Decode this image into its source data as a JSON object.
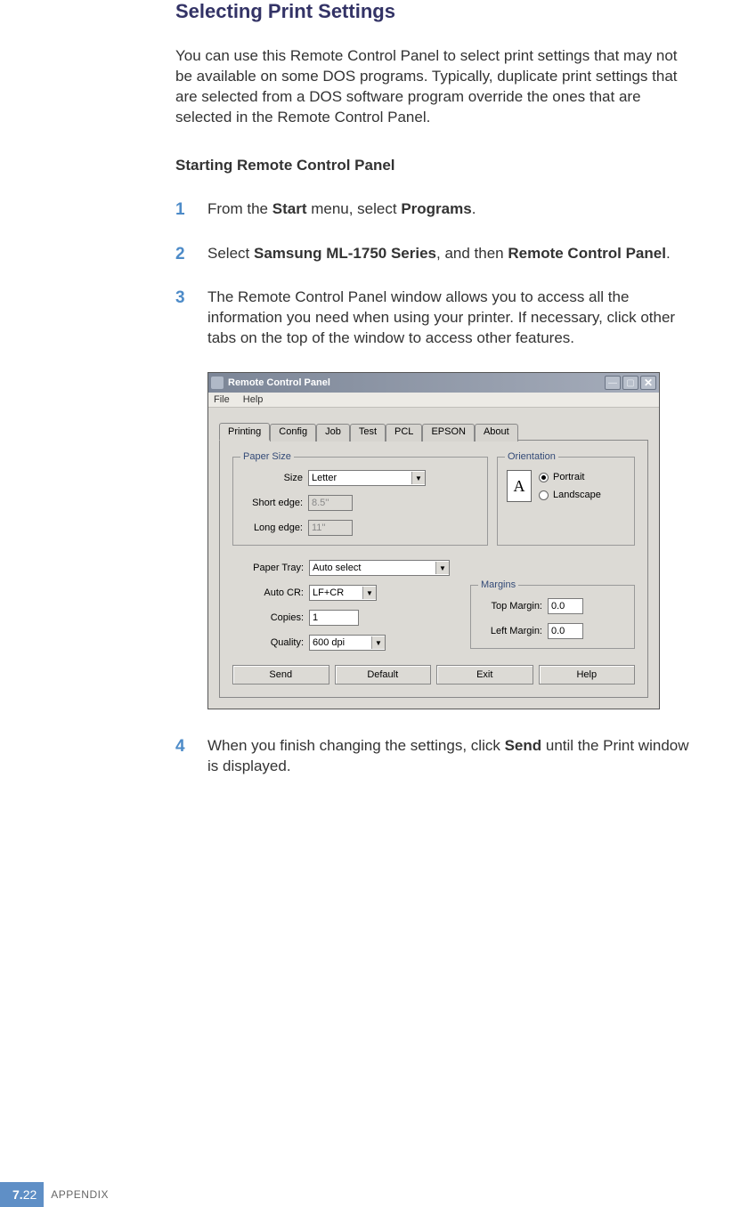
{
  "heading": "Selecting Print Settings",
  "intro": "You can use this Remote Control Panel to select print settings that may not be available on some DOS programs. Typically, duplicate print settings that are selected from a DOS software program override the ones that are selected in the Remote Control Panel.",
  "subheading": "Starting Remote Control Panel",
  "steps": {
    "s1": {
      "num": "1",
      "t1": "From the ",
      "b1": "Start",
      "t2": " menu, select ",
      "b2": "Programs",
      "t3": "."
    },
    "s2": {
      "num": "2",
      "t1": "Select ",
      "b1": "Samsung ML-1750 Series",
      "t2": ", and then ",
      "b2": "Remote Control Panel",
      "t3": "."
    },
    "s3": {
      "num": "3",
      "text": "The Remote Control Panel window allows you to access all the information you need when using your printer. If necessary, click other tabs on the top of the window to access other features."
    },
    "s4": {
      "num": "4",
      "t1": "When you finish changing the settings, click ",
      "b1": "Send",
      "t2": " until the Print window is displayed."
    }
  },
  "dialog": {
    "title": "Remote Control Panel",
    "menu": {
      "file": "File",
      "help": "Help"
    },
    "tabs": [
      "Printing",
      "Config",
      "Job",
      "Test",
      "PCL",
      "EPSON",
      "About"
    ],
    "paper_size": {
      "legend": "Paper Size",
      "size_label": "Size",
      "size_value": "Letter",
      "short_label": "Short edge:",
      "short_value": "8.5''",
      "long_label": "Long edge:",
      "long_value": "11''"
    },
    "orientation": {
      "legend": "Orientation",
      "icon_letter": "A",
      "portrait": "Portrait",
      "landscape": "Landscape"
    },
    "fields": {
      "tray_label": "Paper Tray:",
      "tray_value": "Auto select",
      "autocr_label": "Auto CR:",
      "autocr_value": "LF+CR",
      "copies_label": "Copies:",
      "copies_value": "1",
      "quality_label": "Quality:",
      "quality_value": "600 dpi"
    },
    "margins": {
      "legend": "Margins",
      "top_label": "Top Margin:",
      "top_value": "0.0",
      "left_label": "Left Margin:",
      "left_value": "0.0"
    },
    "buttons": {
      "send": "Send",
      "default": "Default",
      "exit": "Exit",
      "help": "Help"
    }
  },
  "footer": {
    "chapter": "7.",
    "page": "22",
    "label": "APPENDIX"
  }
}
